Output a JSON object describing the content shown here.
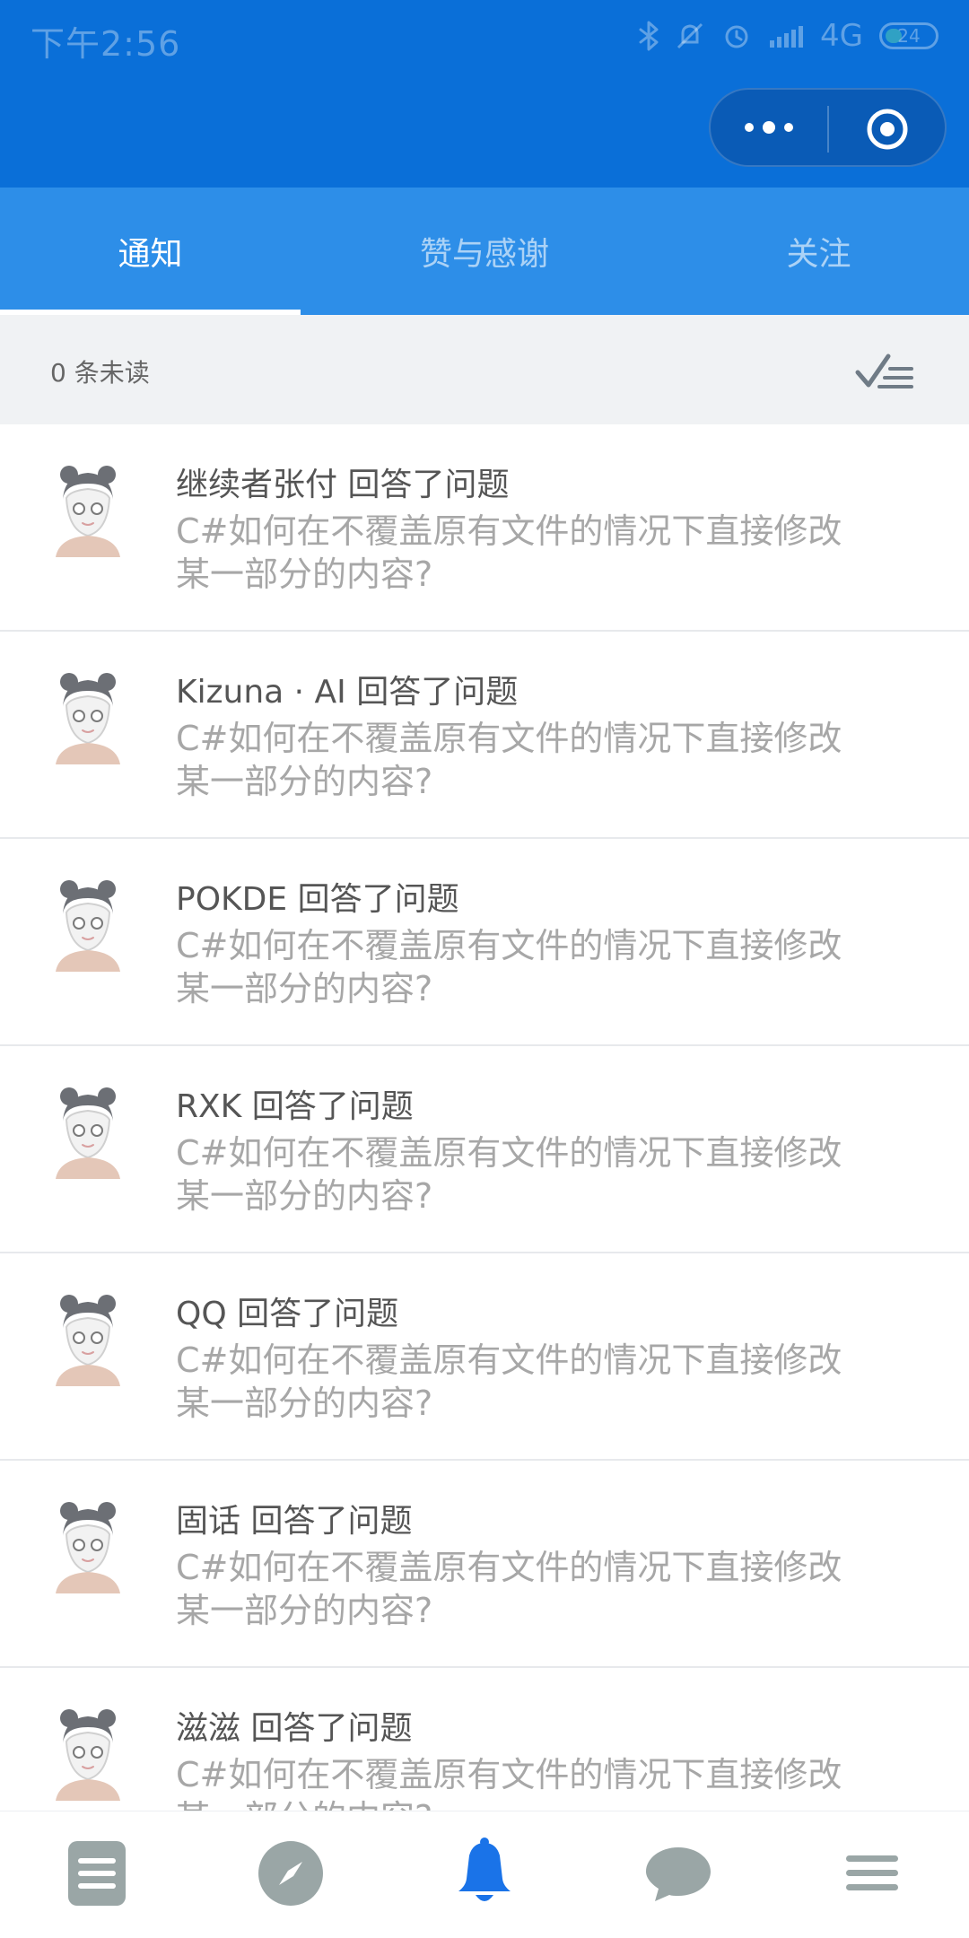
{
  "status": {
    "time": "下午2:56",
    "network": "4G",
    "battery": "24"
  },
  "capsule": {
    "more_icon": "more-dots-icon",
    "close_icon": "target-icon"
  },
  "tabs": [
    {
      "label": "通知",
      "active": true
    },
    {
      "label": "赞与感谢",
      "active": false
    },
    {
      "label": "关注",
      "active": false
    }
  ],
  "unread": {
    "text": "0 条未读",
    "mark_all_icon": "mark-all-read-icon"
  },
  "notifications": [
    {
      "title": "继续者张付 回答了问题",
      "snippet": "C#如何在不覆盖原有文件的情况下直接修改某一部分的内容?"
    },
    {
      "title": "Kizuna · AI 回答了问题",
      "snippet": "C#如何在不覆盖原有文件的情况下直接修改某一部分的内容?"
    },
    {
      "title": "POKDE 回答了问题",
      "snippet": "C#如何在不覆盖原有文件的情况下直接修改某一部分的内容?"
    },
    {
      "title": "RXK 回答了问题",
      "snippet": "C#如何在不覆盖原有文件的情况下直接修改某一部分的内容?"
    },
    {
      "title": "QQ 回答了问题",
      "snippet": "C#如何在不覆盖原有文件的情况下直接修改某一部分的内容?"
    },
    {
      "title": "固话 回答了问题",
      "snippet": "C#如何在不覆盖原有文件的情况下直接修改某一部分的内容?"
    },
    {
      "title": "滋滋 回答了问题",
      "snippet": "C#如何在不覆盖原有文件的情况下直接修改某一部分的内容?"
    }
  ],
  "bottom_nav": [
    {
      "icon": "list-icon",
      "active": false
    },
    {
      "icon": "compass-icon",
      "active": false
    },
    {
      "icon": "bell-icon",
      "active": true
    },
    {
      "icon": "chat-icon",
      "active": false
    },
    {
      "icon": "menu-icon",
      "active": false
    }
  ],
  "colors": {
    "header": "#0a6fd8",
    "tabs": "#2d8ee8",
    "unread_bar": "#f0f2f4",
    "active_nav": "#1a73e8",
    "inactive_nav": "#9aa6a6"
  }
}
